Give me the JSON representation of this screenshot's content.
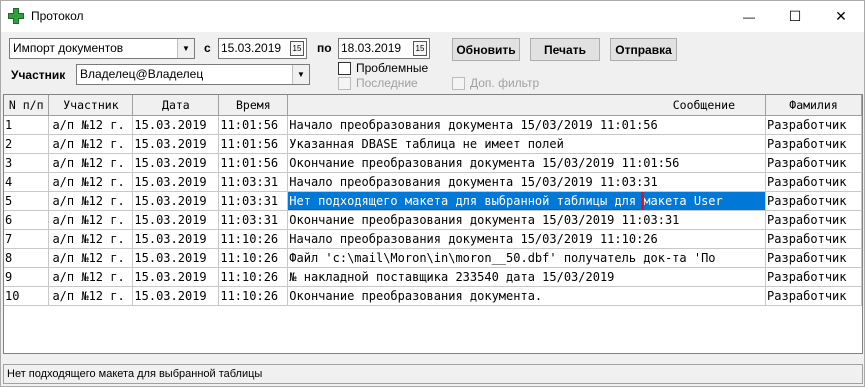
{
  "window": {
    "title": "Протокол",
    "controls": {
      "minimize": "—",
      "maximize": "☐",
      "close": "✕"
    }
  },
  "filters": {
    "operation_combo": "Импорт документов",
    "from_label": "с",
    "from_date": "15.03.2019",
    "to_label": "по",
    "to_date": "18.03.2019",
    "participant_label": "Участник",
    "participant_combo": "Владелец@Владелец",
    "calendar_glyph": "15"
  },
  "buttons": {
    "refresh": "Обновить",
    "print": "Печать",
    "send": "Отправка"
  },
  "checkboxes": {
    "problem": "Проблемные",
    "last": "Последние",
    "extra_filter": "Доп. фильтр"
  },
  "table": {
    "columns": [
      "N п/п",
      "Участник",
      "Дата",
      "Время",
      "Сообщение",
      "Фамилия"
    ],
    "rows": [
      {
        "n": "1",
        "participant": "а/п №12 г.",
        "date": "15.03.2019",
        "time": "11:01:56",
        "message": "Начало преобразования документа 15/03/2019 11:01:56",
        "surname": "Разработчик"
      },
      {
        "n": "2",
        "participant": "а/п №12 г.",
        "date": "15.03.2019",
        "time": "11:01:56",
        "message": "Указанная DBASE таблица не имеет полей",
        "surname": "Разработчик"
      },
      {
        "n": "3",
        "participant": "а/п №12 г.",
        "date": "15.03.2019",
        "time": "11:01:56",
        "message": "Окончание преобразования документа 15/03/2019 11:01:56",
        "surname": "Разработчик"
      },
      {
        "n": "4",
        "participant": "а/п №12 г.",
        "date": "15.03.2019",
        "time": "11:03:31",
        "message": "Начало преобразования документа 15/03/2019 11:03:31",
        "surname": "Разработчик"
      },
      {
        "n": "5",
        "participant": "а/п №12 г.",
        "date": "15.03.2019",
        "time": "11:03:31",
        "message": "Нет подходящего макета для выбранной таблицы для макета User",
        "surname": "Разработчик"
      },
      {
        "n": "6",
        "participant": "а/п №12 г.",
        "date": "15.03.2019",
        "time": "11:03:31",
        "message": "Окончание преобразования документа 15/03/2019 11:03:31",
        "surname": "Разработчик"
      },
      {
        "n": "7",
        "participant": "а/п №12 г.",
        "date": "15.03.2019",
        "time": "11:10:26",
        "message": "Начало преобразования документа 15/03/2019 11:10:26",
        "surname": "Разработчик"
      },
      {
        "n": "8",
        "participant": "а/п №12 г.",
        "date": "15.03.2019",
        "time": "11:10:26",
        "message": "Файл 'c:\\mail\\Moron\\in\\moron__50.dbf' получатель док-та 'По",
        "surname": "Разработчик"
      },
      {
        "n": "9",
        "participant": "а/п №12 г.",
        "date": "15.03.2019",
        "time": "11:10:26",
        "message": " № накладной поставщика 233540 дата 15/03/2019",
        "surname": "Разработчик"
      },
      {
        "n": "10",
        "participant": "а/п №12 г.",
        "date": "15.03.2019",
        "time": "11:10:26",
        "message": "Окончание преобразования документа.",
        "surname": "Разработчик"
      }
    ],
    "selected_row": 4
  },
  "statusbar": {
    "text": "Нет подходящего макета для выбранной таблицы"
  },
  "colors": {
    "selection": "#0078d7",
    "highlight_box": "#e4121d",
    "app_icon": "#2e9e3e"
  }
}
